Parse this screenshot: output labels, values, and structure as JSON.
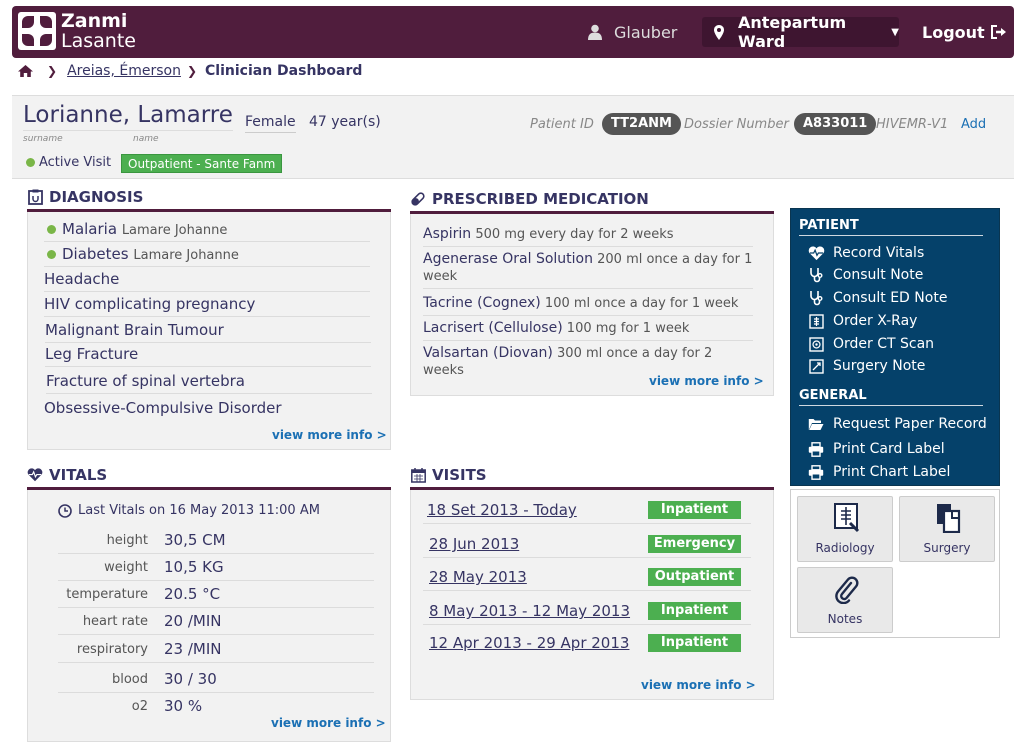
{
  "header": {
    "logo_line1": "Zanmi",
    "logo_line2": "Lasante",
    "user_name": "Glauber",
    "ward": "Antepartum Ward",
    "logout": "Logout"
  },
  "breadcrumb": {
    "patient": "Areias, Émerson",
    "current": "Clinician Dashboard"
  },
  "patient": {
    "name": "Lorianne, Lamarre",
    "surname_label": "surname",
    "name_label": "name",
    "gender": "Female",
    "age": "47 year(s)",
    "patient_id_label": "Patient ID",
    "patient_id": "TT2ANM",
    "dossier_label": "Dossier Number",
    "dossier": "A833011",
    "hivemr_label": "HIVEMR-V1",
    "add_label": "Add",
    "active_visit": "Active Visit",
    "visit_type": "Outpatient - Sante Fanm"
  },
  "diagnosis": {
    "title": "DIAGNOSIS",
    "items": [
      {
        "name": "Malaria",
        "by": "Lamare Johanne"
      },
      {
        "name": "Diabetes",
        "by": "Lamare Johanne"
      },
      {
        "name": "Headache",
        "by": ""
      },
      {
        "name": "HIV complicating pregnancy",
        "by": ""
      },
      {
        "name": "Malignant Brain Tumour",
        "by": ""
      },
      {
        "name": "Leg Fracture",
        "by": ""
      },
      {
        "name": "Fracture of spinal vertebra",
        "by": ""
      },
      {
        "name": "Obsessive-Compulsive Disorder",
        "by": ""
      }
    ],
    "more": "view more info >"
  },
  "medication": {
    "title": "PRESCRIBED MEDICATION",
    "items": [
      {
        "drug": "Aspirin",
        "dose": "500 mg every day for 2 weeks"
      },
      {
        "drug": "Agenerase Oral Solution",
        "dose": "200 ml once a day for 1 week"
      },
      {
        "drug": "Tacrine (Cognex)",
        "dose": "100 ml once a day for 1 week"
      },
      {
        "drug": "Lacrisert (Cellulose)",
        "dose": "100 mg for 1 week"
      },
      {
        "drug": "Valsartan (Diovan)",
        "dose": "300 ml once a day for 2 weeks"
      }
    ],
    "more": "view more info >"
  },
  "vitals": {
    "title": "VITALS",
    "last": "Last Vitals on 16 May 2013 11:00 AM",
    "rows": [
      {
        "label": "height",
        "value": "30,5 CM"
      },
      {
        "label": "weight",
        "value": "10,5 KG"
      },
      {
        "label": "temperature",
        "value": "20.5 °C"
      },
      {
        "label": "heart rate",
        "value": "20 /MIN"
      },
      {
        "label": "respiratory",
        "value": "23  /MIN"
      },
      {
        "label": "blood",
        "value": "30 / 30"
      },
      {
        "label": "o2",
        "value": "30 %"
      }
    ],
    "more": "view more info >"
  },
  "visits": {
    "title": "VISITS",
    "rows": [
      {
        "date": "18 Set 2013 - Today",
        "type": "Inpatient"
      },
      {
        "date": "28 Jun 2013",
        "type": "Emergency"
      },
      {
        "date": "28 May 2013",
        "type": "Outpatient"
      },
      {
        "date": "8 May 2013 - 12 May 2013",
        "type": "Inpatient"
      },
      {
        "date": "12 Apr 2013 - 29 Apr 2013",
        "type": "Inpatient"
      }
    ],
    "more": "view more info >"
  },
  "actions": {
    "patient_head": "PATIENT",
    "patient_items": [
      {
        "label": "Record Vitals",
        "icon": "heart-pulse-icon"
      },
      {
        "label": "Consult Note",
        "icon": "stethoscope-icon"
      },
      {
        "label": "Consult ED Note",
        "icon": "stethoscope-icon"
      },
      {
        "label": "Order X-Ray",
        "icon": "xray-icon"
      },
      {
        "label": "Order CT Scan",
        "icon": "ct-scan-icon"
      },
      {
        "label": "Surgery Note",
        "icon": "surgery-icon"
      }
    ],
    "general_head": "GENERAL",
    "general_items": [
      {
        "label": "Request Paper Record",
        "icon": "folder-open-icon"
      },
      {
        "label": "Print Card Label",
        "icon": "printer-icon"
      },
      {
        "label": "Print Chart Label",
        "icon": "printer-icon"
      }
    ]
  },
  "apps": [
    {
      "label": "Radiology",
      "icon": "radiology-icon"
    },
    {
      "label": "Surgery",
      "icon": "surgery-docs-icon"
    },
    {
      "label": "Notes",
      "icon": "paperclip-icon"
    }
  ],
  "colors": {
    "brand": "#501d3d",
    "action_panel": "#05416a",
    "visit_badge": "#4caf50",
    "link": "#1b70b4"
  }
}
